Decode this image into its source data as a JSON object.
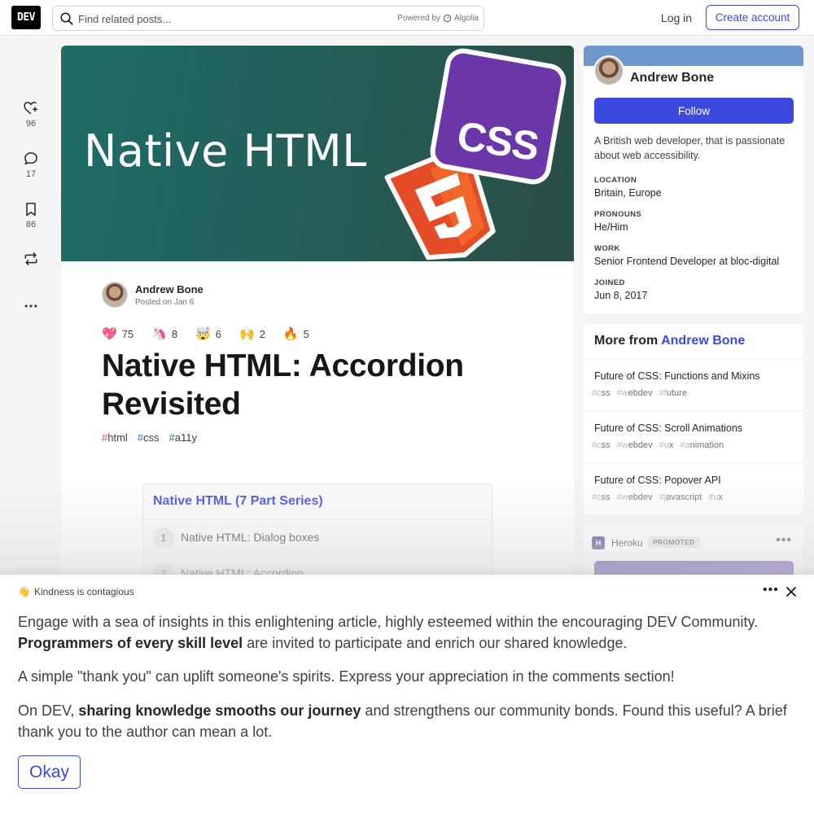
{
  "header": {
    "logo": "DEV",
    "search_placeholder": "Find related posts...",
    "powered_by": "Powered by",
    "powered_brand": "Algolia",
    "login": "Log in",
    "create_account": "Create account"
  },
  "actions": [
    {
      "icon": "heart-plus-icon",
      "count": "96"
    },
    {
      "icon": "comment-icon",
      "count": "17"
    },
    {
      "icon": "bookmark-icon",
      "count": "86"
    },
    {
      "icon": "repost-icon",
      "count": ""
    },
    {
      "icon": "more-icon",
      "count": ""
    }
  ],
  "article": {
    "cover_title": "Native HTML",
    "cover_badge": "CSS",
    "author": "Andrew Bone",
    "posted": "Posted on Jan 6",
    "reactions": [
      {
        "emoji": "💖",
        "count": "75"
      },
      {
        "emoji": "🦄",
        "count": "8"
      },
      {
        "emoji": "🤯",
        "count": "6"
      },
      {
        "emoji": "🙌",
        "count": "2"
      },
      {
        "emoji": "🔥",
        "count": "5"
      }
    ],
    "title": "Native HTML: Accordion Revisited",
    "tags": [
      {
        "hash": "#",
        "name": "html"
      },
      {
        "hash": "#",
        "name": "css"
      },
      {
        "hash": "#",
        "name": "a11y"
      }
    ],
    "series": {
      "title": "Native HTML (7 Part Series)",
      "items": [
        {
          "num": "1",
          "label": "Native HTML: Dialog boxes"
        },
        {
          "num": "2",
          "label": "Native HTML: Accordion"
        }
      ]
    }
  },
  "profile": {
    "name": "Andrew Bone",
    "follow": "Follow",
    "bio": "A British web developer, that is passionate about web accessibility.",
    "fields": [
      {
        "label": "LOCATION",
        "value": "Britain, Europe"
      },
      {
        "label": "PRONOUNS",
        "value": "He/Him"
      },
      {
        "label": "WORK",
        "value": "Senior Frontend Developer at bloc-digital"
      },
      {
        "label": "JOINED",
        "value": "Jun 8, 2017"
      }
    ]
  },
  "more_from": {
    "prefix": "More from",
    "author": "Andrew Bone",
    "items": [
      {
        "title": "Future of CSS: Functions and Mixins",
        "tags": [
          "#css",
          "#webdev",
          "#future"
        ]
      },
      {
        "title": "Future of CSS: Scroll Animations",
        "tags": [
          "#css",
          "#webdev",
          "#ux",
          "#animation"
        ]
      },
      {
        "title": "Future of CSS: Popover API",
        "tags": [
          "#css",
          "#webdev",
          "#javascript",
          "#ux"
        ]
      }
    ]
  },
  "promo": {
    "logo_letter": "H",
    "name": "Heroku",
    "badge": "PROMOTED"
  },
  "banner": {
    "emoji": "👋",
    "heading": "Kindness is contagious",
    "p1_a": "Engage with a sea of insights in this enlightening article, highly esteemed within the encouraging DEV Community.",
    "p1_b": "Programmers of every skill level",
    "p1_c": "are invited to participate and enrich our shared knowledge.",
    "p2": "A simple \"thank you\" can uplift someone's spirits. Express your appreciation in the comments section!",
    "p3_a": "On DEV,",
    "p3_b": "sharing knowledge smooths our journey",
    "p3_c": "and strengthens our community bonds. Found this useful? A brief thank you to the author can mean a lot.",
    "okay": "Okay"
  },
  "colors": {
    "accent": "#3b49df",
    "cover_teal": "#1e6d68",
    "css_purple": "#6b36a8",
    "html_orange": "#e34c26"
  }
}
